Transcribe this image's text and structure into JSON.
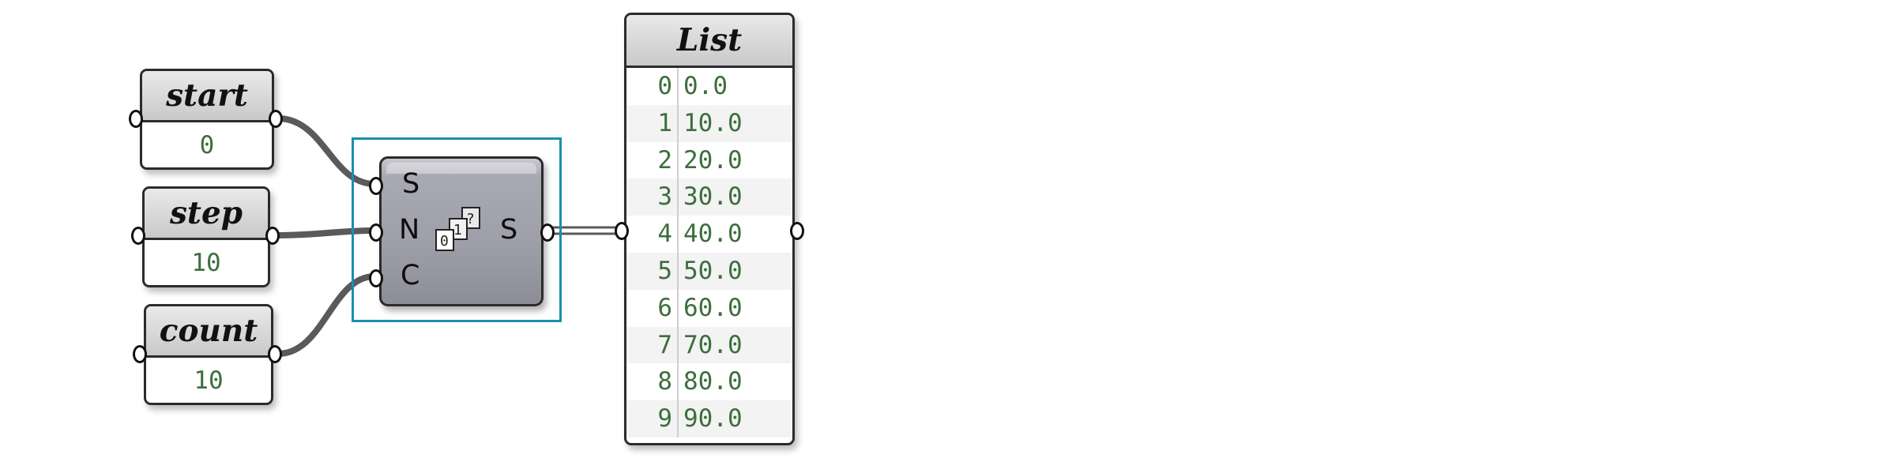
{
  "params": [
    {
      "id": "start",
      "title": "start",
      "value": "0"
    },
    {
      "id": "step",
      "title": "step",
      "value": "10"
    },
    {
      "id": "count",
      "title": "count",
      "value": "10"
    }
  ],
  "component": {
    "inputs": [
      "S",
      "N",
      "C"
    ],
    "output": "S",
    "icon": "series-icon",
    "selected": true
  },
  "list_panel": {
    "title": "List",
    "rows": [
      {
        "index": "0",
        "value": "0.0"
      },
      {
        "index": "1",
        "value": "10.0"
      },
      {
        "index": "2",
        "value": "20.0"
      },
      {
        "index": "3",
        "value": "30.0"
      },
      {
        "index": "4",
        "value": "40.0"
      },
      {
        "index": "5",
        "value": "50.0"
      },
      {
        "index": "6",
        "value": "60.0"
      },
      {
        "index": "7",
        "value": "70.0"
      },
      {
        "index": "8",
        "value": "80.0"
      },
      {
        "index": "9",
        "value": "90.0"
      }
    ]
  },
  "colors": {
    "selection": "#1a8fb0",
    "value_text": "#3d6e3d",
    "wire": "#5a5a5a"
  }
}
